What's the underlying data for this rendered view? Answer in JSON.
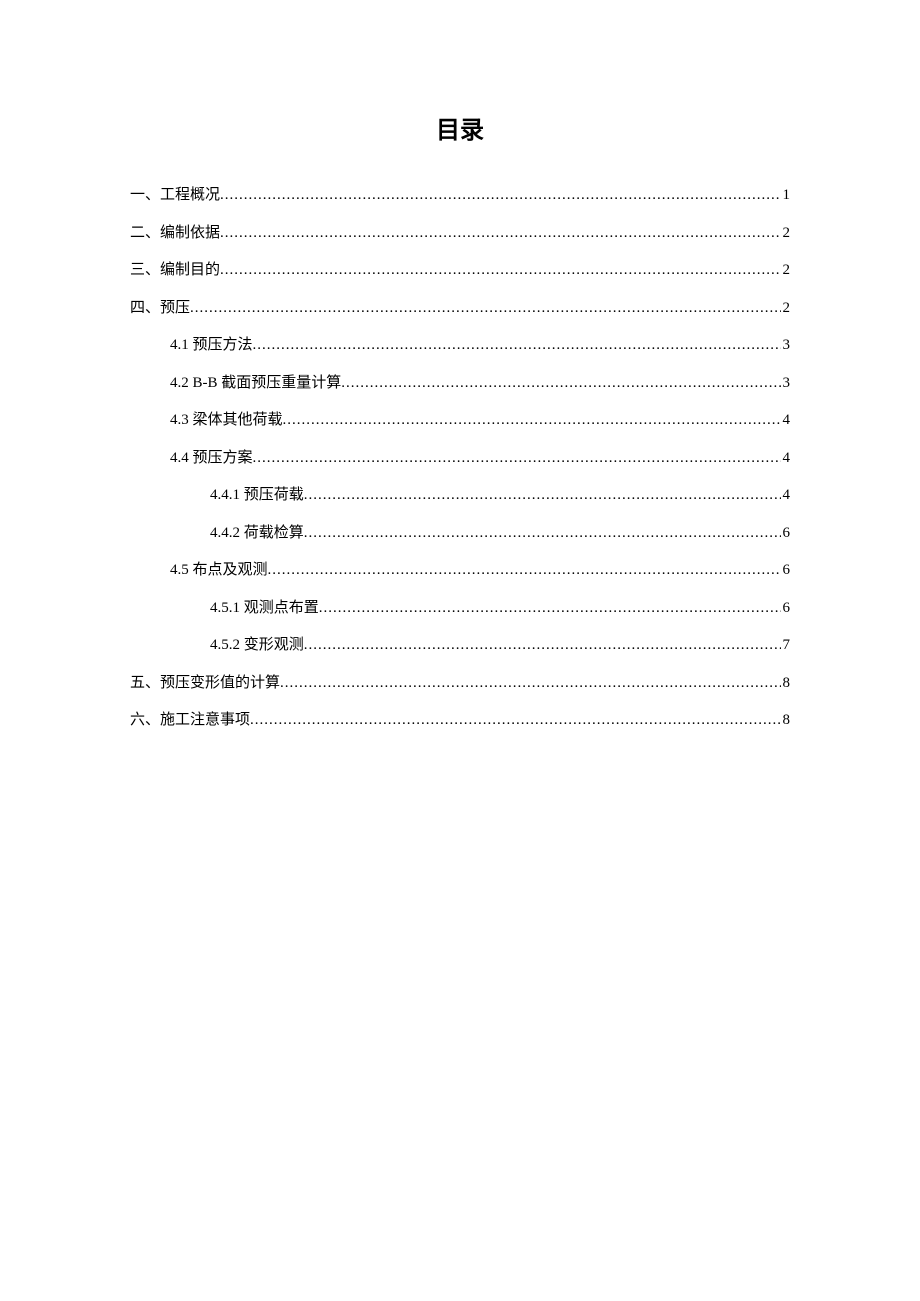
{
  "title": "目录",
  "toc": {
    "items": [
      {
        "indent": 0,
        "label": "一、工程概况",
        "page": "1"
      },
      {
        "indent": 0,
        "label": "二、编制依据",
        "page": "2"
      },
      {
        "indent": 0,
        "label": "三、编制目的",
        "page": "2"
      },
      {
        "indent": 0,
        "label": "四、预压",
        "page": "2"
      },
      {
        "indent": 1,
        "label": "4.1 预压方法",
        "page": "3"
      },
      {
        "indent": 1,
        "label": "4.2 B-B 截面预压重量计算",
        "page": "3"
      },
      {
        "indent": 1,
        "label": "4.3 梁体其他荷载",
        "page": "4"
      },
      {
        "indent": 1,
        "label": "4.4 预压方案",
        "page": "4"
      },
      {
        "indent": 2,
        "label": "4.4.1 预压荷载",
        "page": "4"
      },
      {
        "indent": 2,
        "label": "4.4.2 荷载检算",
        "page": "6"
      },
      {
        "indent": 1,
        "label": "4.5 布点及观测",
        "page": "6"
      },
      {
        "indent": 2,
        "label": "4.5.1 观测点布置",
        "page": "6"
      },
      {
        "indent": 2,
        "label": "4.5.2 变形观测",
        "page": "7"
      },
      {
        "indent": 0,
        "label": "五、预压变形值的计算",
        "page": "8"
      },
      {
        "indent": 0,
        "label": "六、施工注意事项",
        "page": "8"
      }
    ]
  }
}
